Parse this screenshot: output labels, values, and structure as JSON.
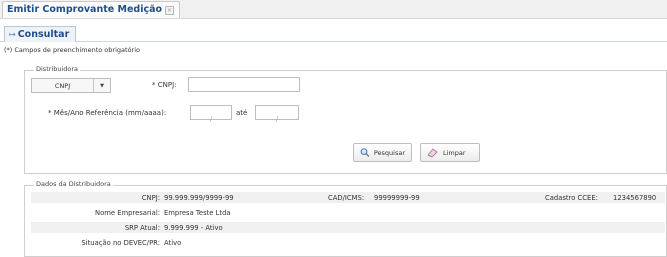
{
  "window": {
    "tab_title": "Emitir Comprovante Medição",
    "subtab_label": "Consultar"
  },
  "form": {
    "required_note": "(*) Campos de preenchimento obrigatório",
    "legend": "Distribuidora",
    "doc_type": "CNPJ",
    "cnpj_label": "* CNPJ:",
    "cnpj_value": "",
    "period_label": "* Mês/Ano Referência (mm/aaaa):",
    "date_sep": "/",
    "until_label": "até",
    "search_button": "Pesquisar",
    "clear_button": "Limpar"
  },
  "details": {
    "legend": "Dados da Distribuidora",
    "cnpj_label": "CNPJ:",
    "cnpj_value": "99.999.999/9999-99",
    "cad_label": "CAD/ICMS:",
    "cad_value": "99999999-99",
    "ccee_label": "Cadastro CCEE:",
    "ccee_value": "1234567890",
    "name_label": "Nome Empresarial:",
    "name_value": "Empresa Teste Ltda",
    "srp_label": "SRP Atual:",
    "srp_value": "9.999.999 - Ativo",
    "situation_label": "Situação no DEVEC/PR:",
    "situation_value": "Ativo"
  }
}
